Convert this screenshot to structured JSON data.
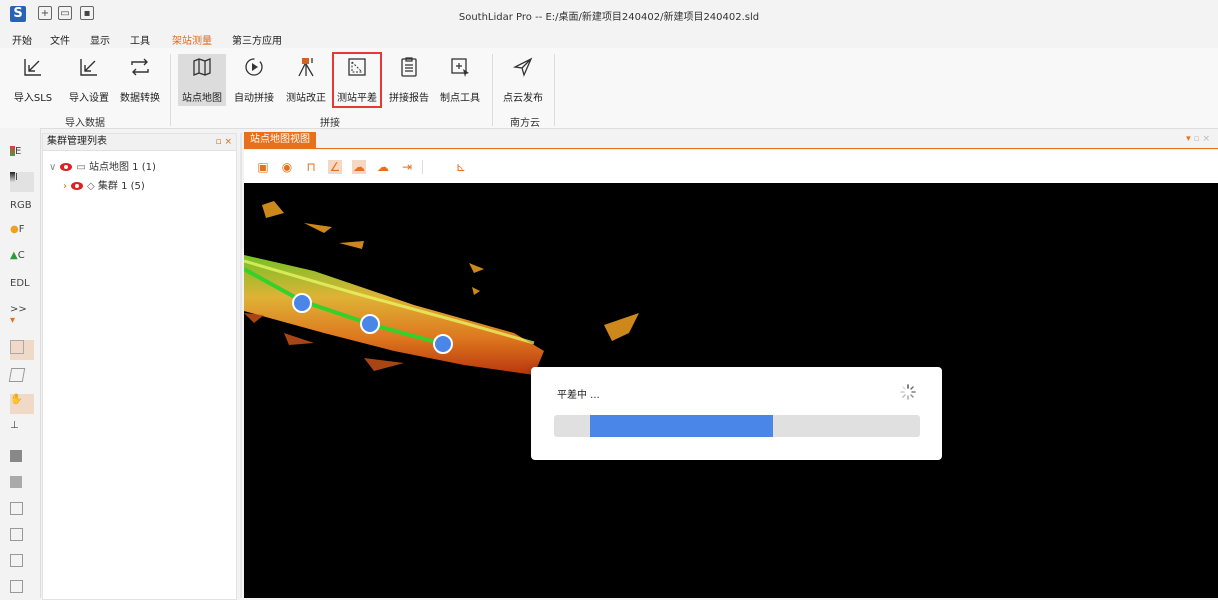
{
  "window": {
    "title": "SouthLidar Pro -- E:/桌面/新建项目240402/新建项目240402.sld",
    "logo_letter": "S"
  },
  "menu": {
    "items": [
      "开始",
      "文件",
      "显示",
      "工具",
      "架站测量",
      "第三方应用"
    ],
    "active_index": 4
  },
  "ribbon": {
    "buttons": [
      {
        "label": "导入SLS",
        "icon": "import-arrow-icon"
      },
      {
        "label": "导入设置",
        "icon": "import-settings-icon"
      },
      {
        "label": "数据转换",
        "icon": "convert-arrows-icon"
      },
      {
        "label": "站点地图",
        "icon": "map-icon"
      },
      {
        "label": "自动拼接",
        "icon": "play-circle-icon"
      },
      {
        "label": "测站改正",
        "icon": "tripod-icon"
      },
      {
        "label": "测站平差",
        "icon": "adjust-icon"
      },
      {
        "label": "拼接报告",
        "icon": "report-icon"
      },
      {
        "label": "制点工具",
        "icon": "point-tool-icon"
      },
      {
        "label": "点云发布",
        "icon": "send-icon"
      }
    ],
    "groups": [
      "导入数据",
      "拼接",
      "南方云"
    ]
  },
  "left_tools": [
    "E",
    "I",
    "RGB",
    "F",
    "C",
    "EDL",
    ">>"
  ],
  "panel": {
    "title": "集群管理列表",
    "tree": [
      {
        "label": "站点地图 1 (1)",
        "level": 0
      },
      {
        "label": "集群 1 (5)",
        "level": 1
      }
    ]
  },
  "view": {
    "tab": "站点地图视图"
  },
  "dialog": {
    "message": "平差中 ...",
    "progress": 0.5
  },
  "colors": {
    "accent": "#e8701a",
    "progress": "#4a86e8",
    "highlight": "#e53935",
    "station": "#4a86e8"
  }
}
